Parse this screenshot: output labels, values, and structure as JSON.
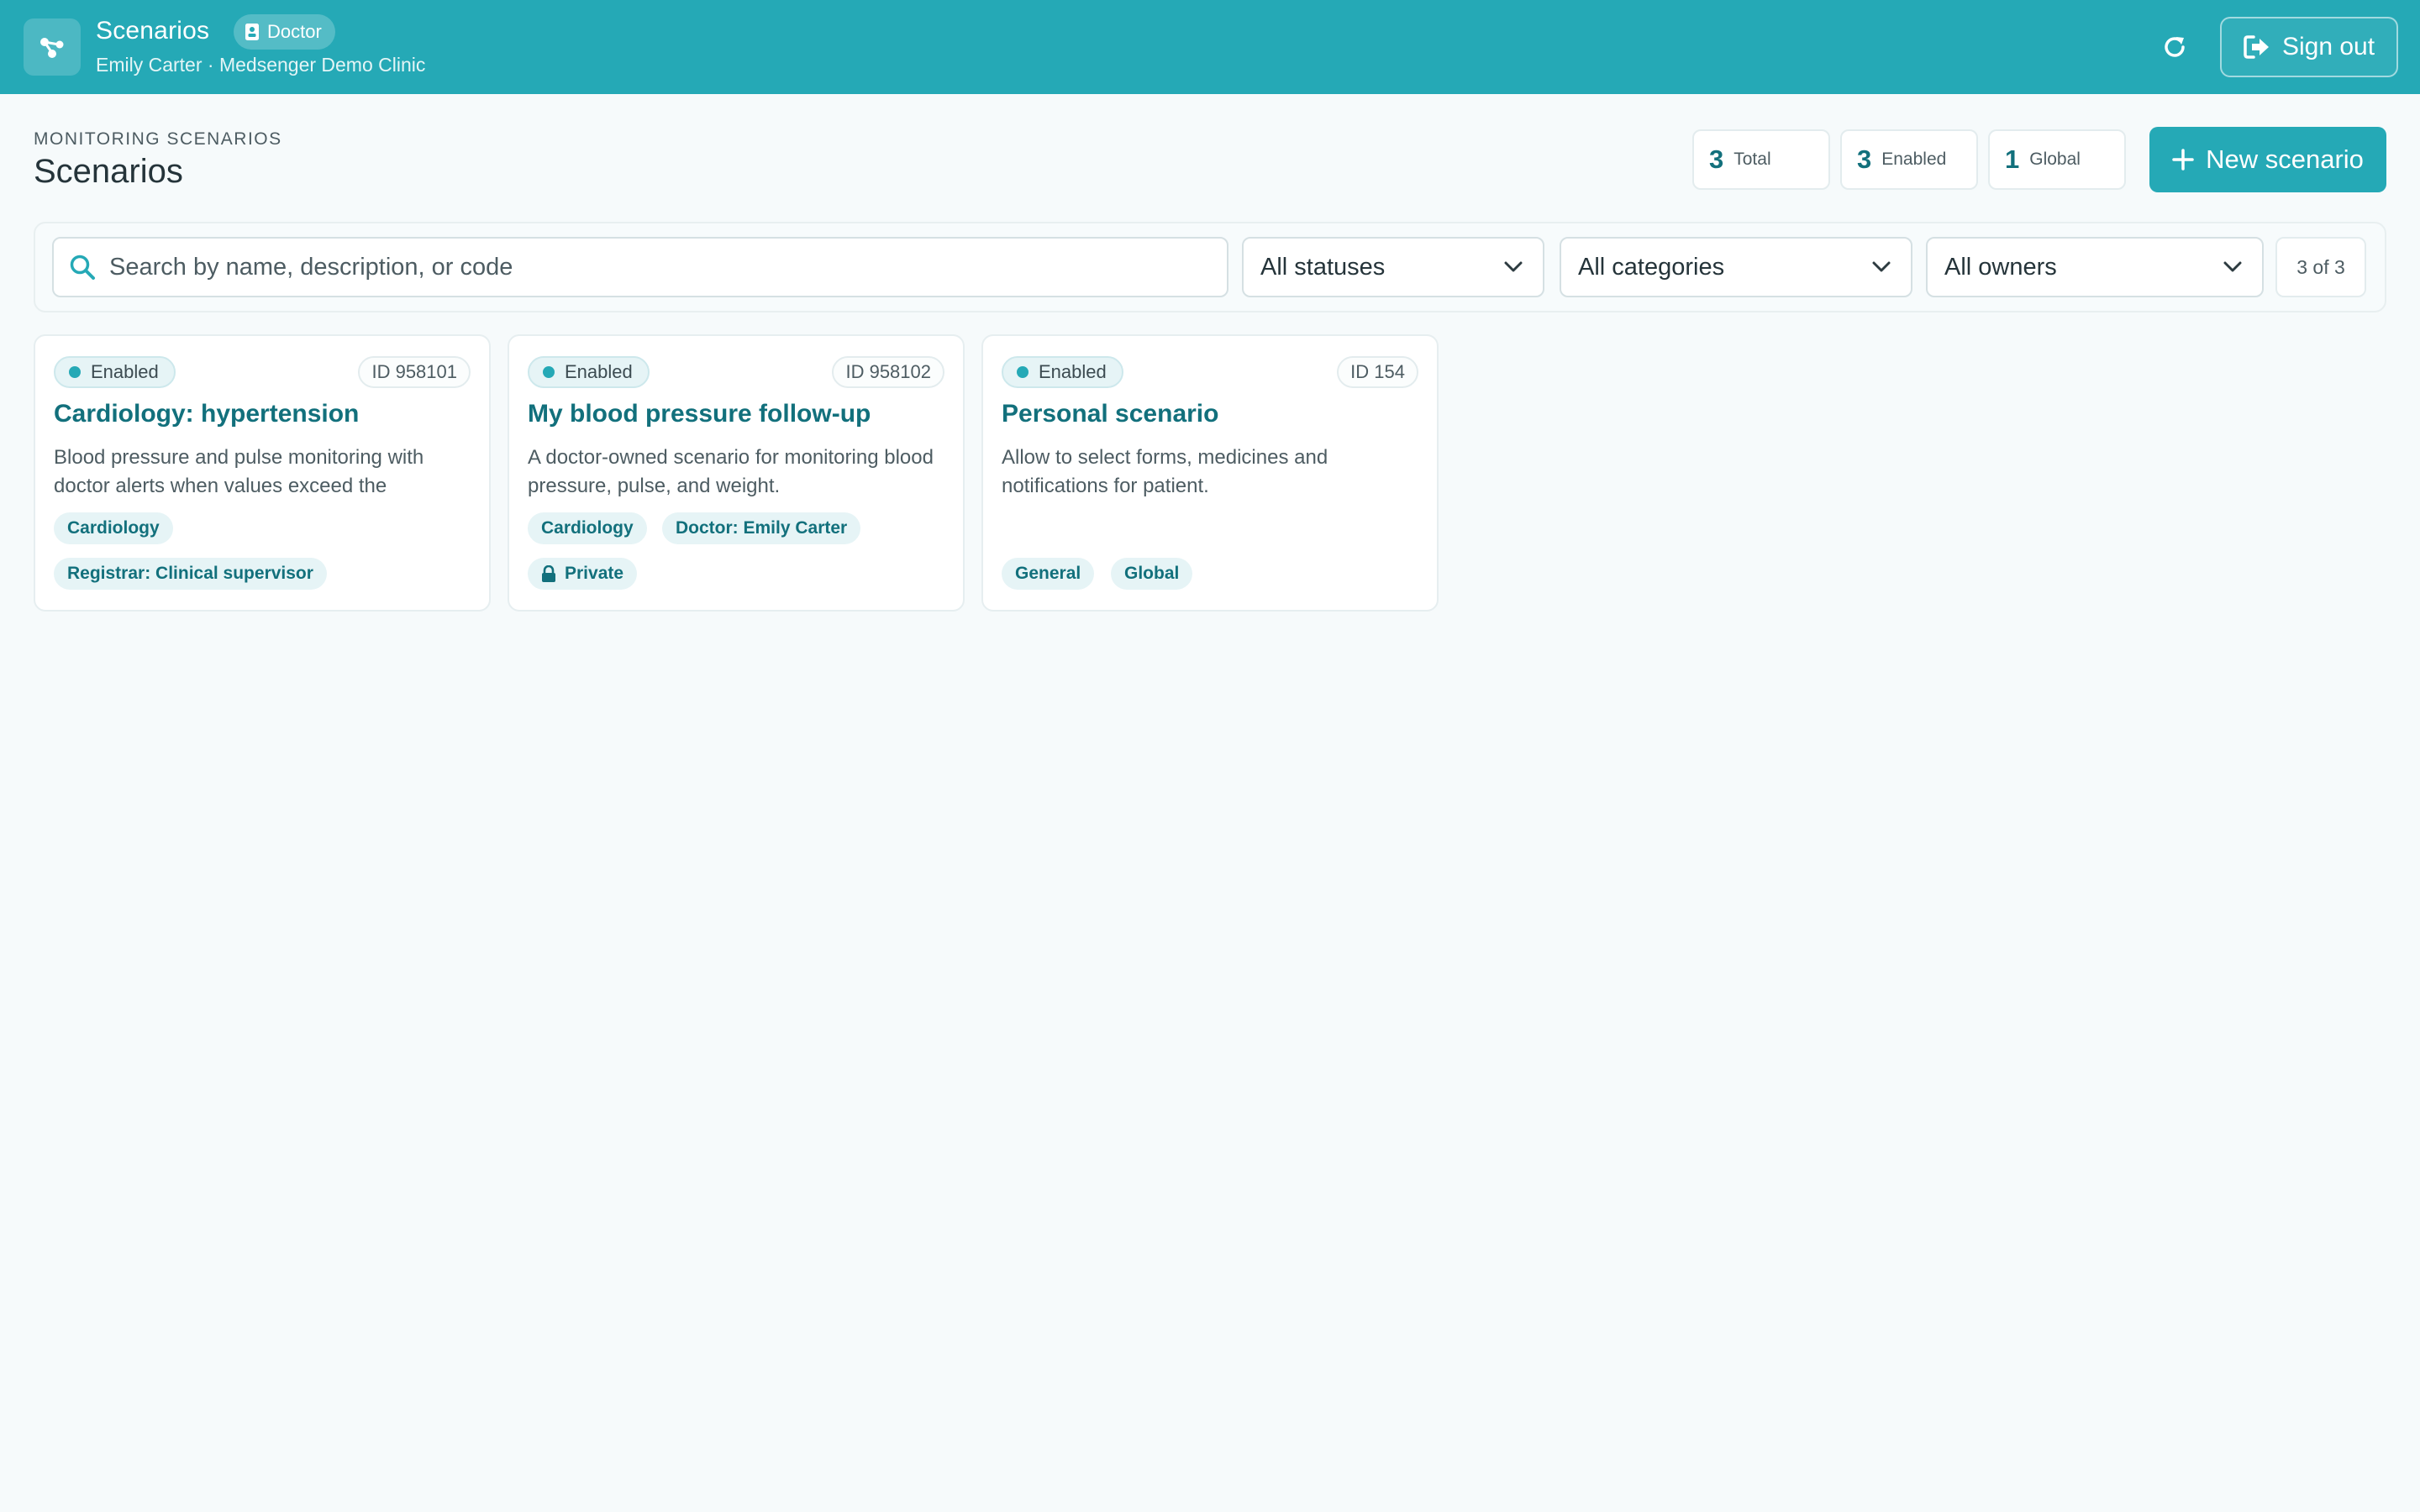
{
  "header": {
    "app_icon": "workflow-nodes-icon",
    "title": "Scenarios",
    "role_badge": "Doctor",
    "role_icon": "id-badge-icon",
    "subtitle": "Emily Carter · Medsenger Demo Clinic",
    "refresh_icon": "refresh-icon",
    "sign_out_label": "Sign out",
    "sign_out_icon": "sign-out-icon"
  },
  "page": {
    "eyebrow": "MONITORING SCENARIOS",
    "title": "Scenarios"
  },
  "stats": [
    {
      "value": "3",
      "label": "Total"
    },
    {
      "value": "3",
      "label": "Enabled"
    },
    {
      "value": "1",
      "label": "Global"
    }
  ],
  "new_scenario": {
    "label": "New scenario",
    "icon": "plus-icon"
  },
  "filters": {
    "search_placeholder": "Search by name, description, or code",
    "search_value": "",
    "status": "All statuses",
    "category": "All categories",
    "owner": "All owners",
    "count": "3 of 3"
  },
  "cards": [
    {
      "status": "Enabled",
      "id": "ID 958101",
      "title": "Cardiology: hypertension",
      "description": "Blood pressure and pulse monitoring with doctor alerts when values exceed the",
      "tags": [
        "Cardiology",
        "Registrar: Clinical supervisor"
      ]
    },
    {
      "status": "Enabled",
      "id": "ID 958102",
      "title": "My blood pressure follow-up",
      "description": "A doctor-owned scenario for monitoring blood pressure, pulse, and weight.",
      "tags": [
        "Cardiology",
        "Doctor: Emily Carter",
        "Private"
      ]
    },
    {
      "status": "Enabled",
      "id": "ID 154",
      "title": "Personal scenario",
      "description": "Allow to select forms, medicines and notifications for patient.",
      "tags": [
        "General",
        "Global"
      ]
    }
  ],
  "colors": {
    "primary": "#25a9b6",
    "primary_dark": "#12707c",
    "background": "#f6fafb",
    "tag_bg": "#e6f4f6"
  }
}
